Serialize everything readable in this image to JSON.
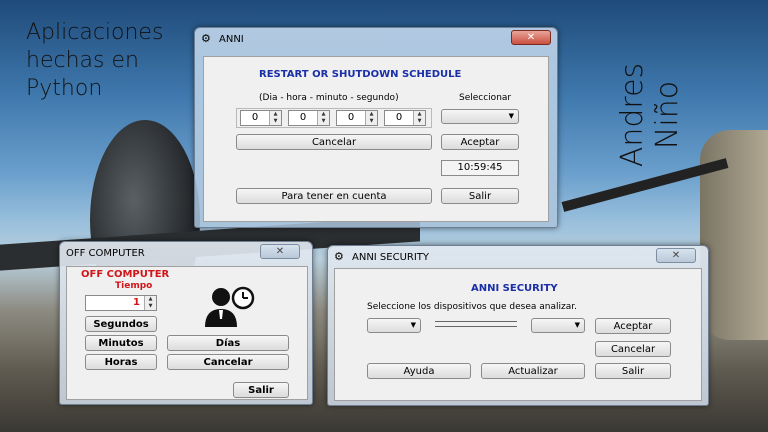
{
  "overlay": {
    "caption_line1": "Aplicaciones",
    "caption_line2": "hechas en",
    "caption_line3": "Python",
    "author": "Andres Niño"
  },
  "anni_window": {
    "title": "ANNI",
    "heading": "RESTART OR SHUTDOWN SCHEDULE",
    "format_label": "(Dia - hora - minuto - segundo)",
    "select_label": "Seleccionar",
    "spinners": [
      "0",
      "0",
      "0",
      "0"
    ],
    "cancel": "Cancelar",
    "accept": "Aceptar",
    "clock": "10:59:45",
    "notes_button": "Para tener en cuenta",
    "exit": "Salir",
    "close": "✕"
  },
  "off_window": {
    "title": "OFF COMPUTER",
    "heading": "OFF COMPUTER",
    "time_label": "Tiempo",
    "time_value": "1",
    "seconds": "Segundos",
    "minutes": "Minutos",
    "days": "Días",
    "hours": "Horas",
    "cancel": "Cancelar",
    "exit": "Salir",
    "close": "✕"
  },
  "security_window": {
    "title": "ANNI SECURITY",
    "heading": "ANNI SECURITY",
    "instruction": "Seleccione los dispositivos que desea analizar.",
    "accept": "Aceptar",
    "cancel": "Cancelar",
    "help": "Ayuda",
    "refresh": "Actualizar",
    "exit": "Salir",
    "close": "✕"
  },
  "colors": {
    "heading_blue": "#1a2ea8",
    "heading_red": "#d0161a"
  }
}
